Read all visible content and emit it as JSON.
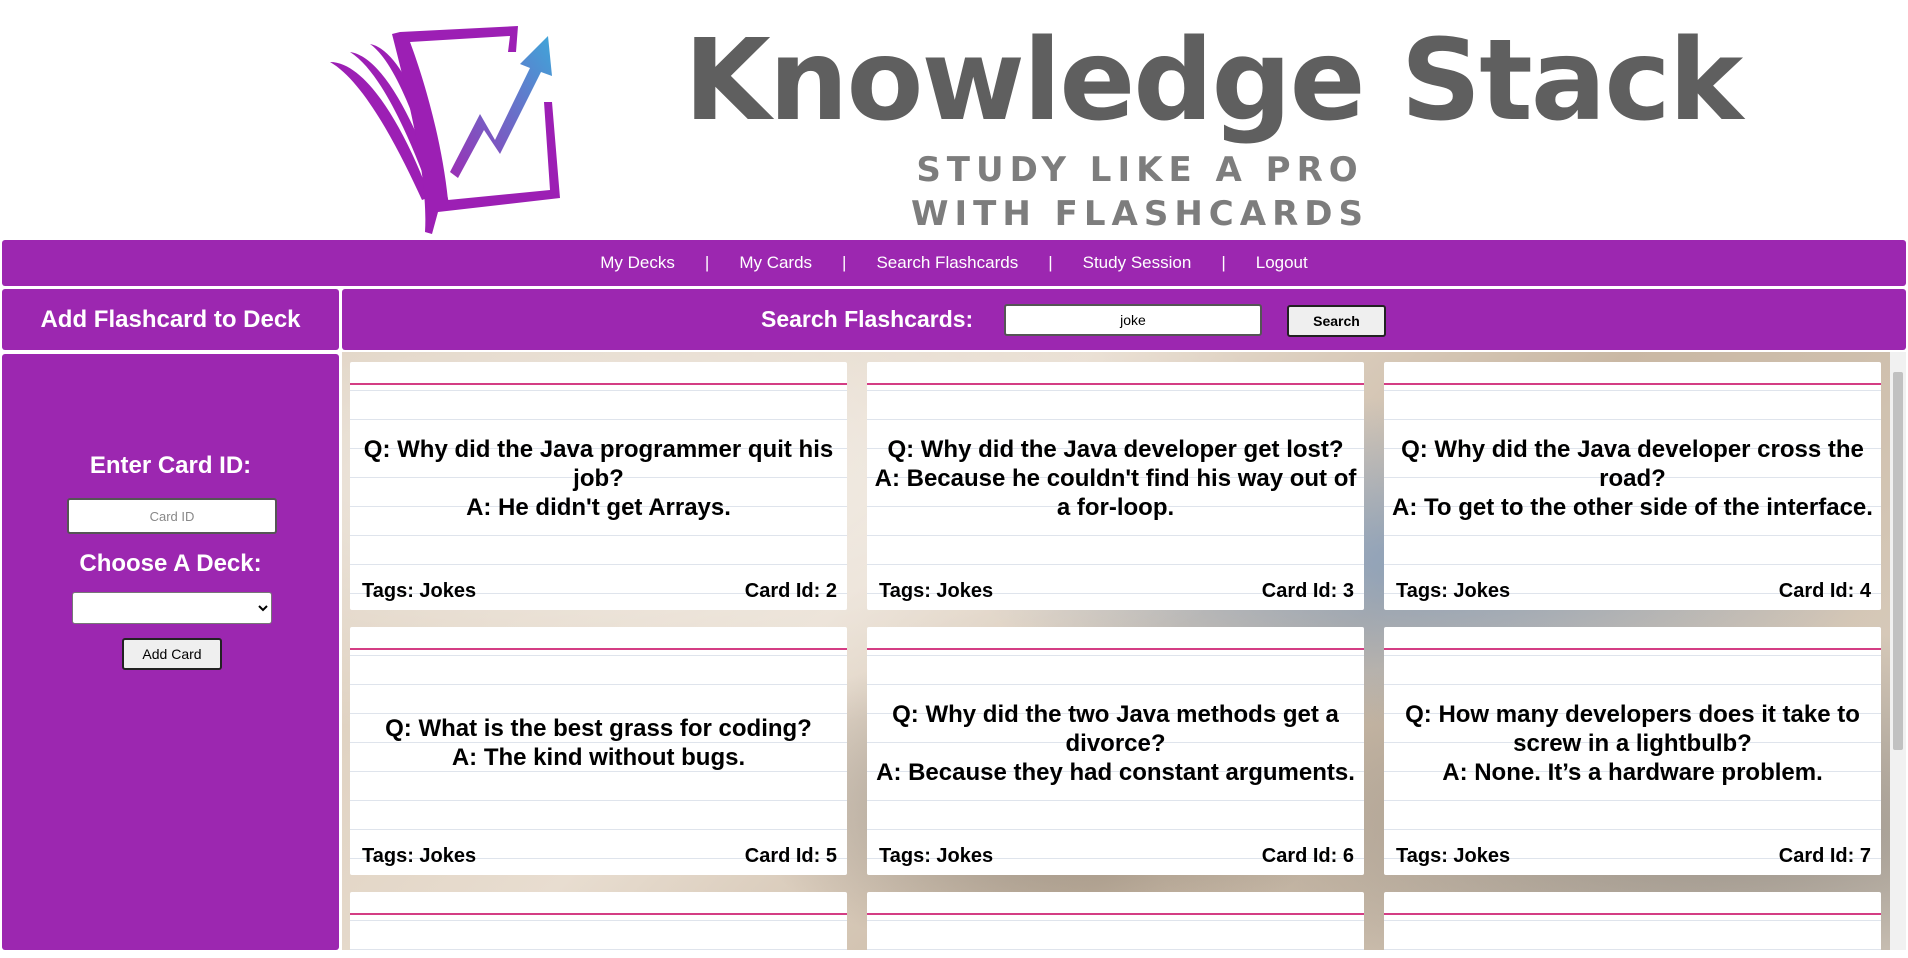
{
  "brand": {
    "title": "Knowledge Stack",
    "tagline": "STUDY LIKE A PRO WITH FLASHCARDS",
    "colors": {
      "primary": "#9c27b0",
      "title": "#5f5f5f",
      "accent_line": "#d43d84"
    }
  },
  "nav": {
    "items": [
      {
        "label": "My Decks"
      },
      {
        "label": "My Cards"
      },
      {
        "label": "Search Flashcards"
      },
      {
        "label": "Study Session"
      },
      {
        "label": "Logout"
      }
    ],
    "separator": "|"
  },
  "add_panel": {
    "title": "Add Flashcard to Deck",
    "card_id_label": "Enter Card ID:",
    "card_id_placeholder": "Card ID",
    "deck_label": "Choose A Deck:",
    "deck_selected": "",
    "add_button": "Add Card"
  },
  "search": {
    "label": "Search Flashcards:",
    "query": "joke",
    "button": "Search"
  },
  "cards": [
    {
      "question": "Q: Why did the Java programmer quit his job?",
      "answer": "A: He didn't get Arrays.",
      "tags": "Tags: Jokes",
      "id": "Card Id: 2"
    },
    {
      "question": "Q: Why did the Java developer get lost?",
      "answer": "A: Because he couldn't find his way out of a for-loop.",
      "tags": "Tags: Jokes",
      "id": "Card Id: 3"
    },
    {
      "question": "Q: Why did the Java developer cross the road?",
      "answer": "A: To get to the other side of the interface.",
      "tags": "Tags: Jokes",
      "id": "Card Id: 4"
    },
    {
      "question": "Q: What is the best grass for coding?",
      "answer": "A: The kind without bugs.",
      "tags": "Tags: Jokes",
      "id": "Card Id: 5"
    },
    {
      "question": "Q: Why did the two Java methods get a divorce?",
      "answer": "A: Because they had constant arguments.",
      "tags": "Tags: Jokes",
      "id": "Card Id: 6"
    },
    {
      "question": "Q: How many developers does it take to screw in a lightbulb?",
      "answer": "A: None. It’s a hardware problem.",
      "tags": "Tags: Jokes",
      "id": "Card Id: 7"
    }
  ],
  "icons": {
    "logo": "flashcard-stack-arrow-icon",
    "select_caret": "chevron-down-icon"
  }
}
